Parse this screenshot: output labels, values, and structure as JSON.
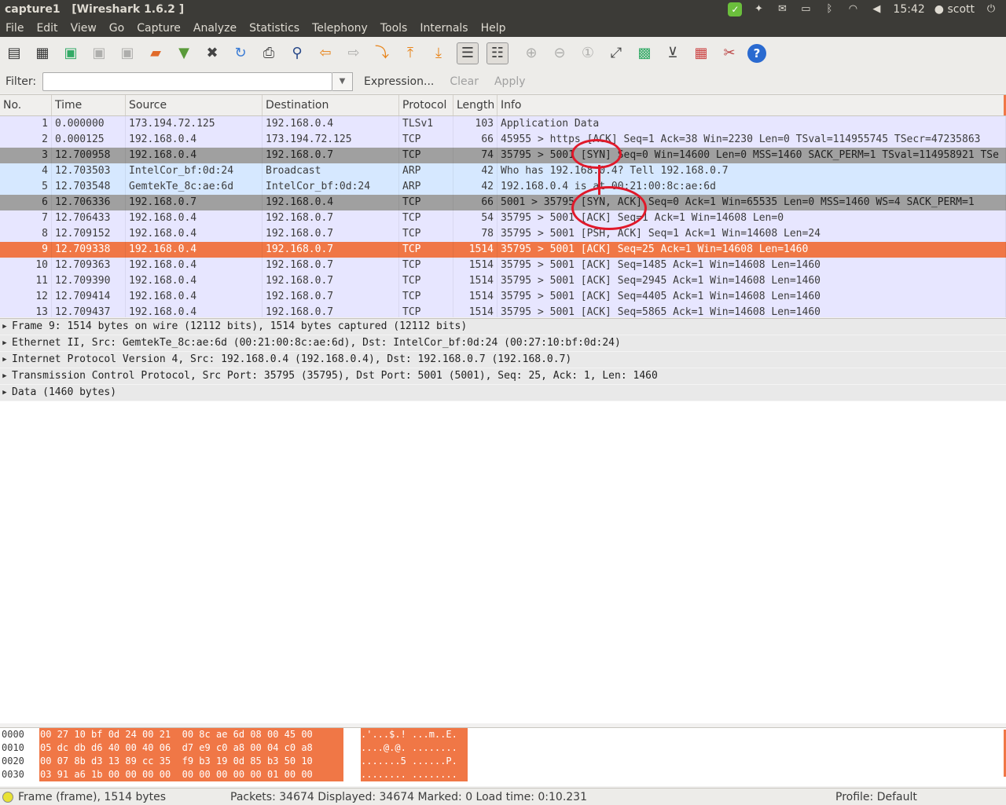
{
  "window": {
    "title": "capture1   [Wireshark 1.6.2 ]",
    "clock": "15:42",
    "user": "scott"
  },
  "menu": [
    "File",
    "Edit",
    "View",
    "Go",
    "Capture",
    "Analyze",
    "Statistics",
    "Telephony",
    "Tools",
    "Internals",
    "Help"
  ],
  "filter": {
    "label": "Filter:",
    "value": "",
    "expression": "Expression...",
    "clear": "Clear",
    "apply": "Apply"
  },
  "columns": {
    "no": "No.",
    "time": "Time",
    "source": "Source",
    "destination": "Destination",
    "protocol": "Protocol",
    "length": "Length",
    "info": "Info"
  },
  "packets": [
    {
      "no": "1",
      "time": "0.000000",
      "src": "173.194.72.125",
      "dst": "192.168.0.4",
      "proto": "TLSv1",
      "len": "103",
      "info": "Application Data"
    },
    {
      "no": "2",
      "time": "0.000125",
      "src": "192.168.0.4",
      "dst": "173.194.72.125",
      "proto": "TCP",
      "len": "66",
      "info": "45955 > https [ACK] Seq=1 Ack=38 Win=2230 Len=0 TSval=114955745 TSecr=47235863"
    },
    {
      "no": "3",
      "time": "12.700958",
      "src": "192.168.0.4",
      "dst": "192.168.0.7",
      "proto": "TCP",
      "len": "74",
      "info": "35795 > 5001 [SYN] Seq=0 Win=14600 Len=0 MSS=1460 SACK_PERM=1 TSval=114958921 TSe"
    },
    {
      "no": "4",
      "time": "12.703503",
      "src": "IntelCor_bf:0d:24",
      "dst": "Broadcast",
      "proto": "ARP",
      "len": "42",
      "info": "Who has 192.168.0.4?  Tell 192.168.0.7"
    },
    {
      "no": "5",
      "time": "12.703548",
      "src": "GemtekTe_8c:ae:6d",
      "dst": "IntelCor_bf:0d:24",
      "proto": "ARP",
      "len": "42",
      "info": "192.168.0.4 is at 00:21:00:8c:ae:6d"
    },
    {
      "no": "6",
      "time": "12.706336",
      "src": "192.168.0.7",
      "dst": "192.168.0.4",
      "proto": "TCP",
      "len": "66",
      "info": "5001 > 35795 [SYN, ACK] Seq=0 Ack=1 Win=65535 Len=0 MSS=1460 WS=4 SACK_PERM=1"
    },
    {
      "no": "7",
      "time": "12.706433",
      "src": "192.168.0.4",
      "dst": "192.168.0.7",
      "proto": "TCP",
      "len": "54",
      "info": "35795 > 5001 [ACK] Seq=1 Ack=1 Win=14608 Len=0"
    },
    {
      "no": "8",
      "time": "12.709152",
      "src": "192.168.0.4",
      "dst": "192.168.0.7",
      "proto": "TCP",
      "len": "78",
      "info": "35795 > 5001 [PSH, ACK] Seq=1 Ack=1 Win=14608 Len=24"
    },
    {
      "no": "9",
      "time": "12.709338",
      "src": "192.168.0.4",
      "dst": "192.168.0.7",
      "proto": "TCP",
      "len": "1514",
      "info": "35795 > 5001 [ACK] Seq=25 Ack=1 Win=14608 Len=1460"
    },
    {
      "no": "10",
      "time": "12.709363",
      "src": "192.168.0.4",
      "dst": "192.168.0.7",
      "proto": "TCP",
      "len": "1514",
      "info": "35795 > 5001 [ACK] Seq=1485 Ack=1 Win=14608 Len=1460"
    },
    {
      "no": "11",
      "time": "12.709390",
      "src": "192.168.0.4",
      "dst": "192.168.0.7",
      "proto": "TCP",
      "len": "1514",
      "info": "35795 > 5001 [ACK] Seq=2945 Ack=1 Win=14608 Len=1460"
    },
    {
      "no": "12",
      "time": "12.709414",
      "src": "192.168.0.4",
      "dst": "192.168.0.7",
      "proto": "TCP",
      "len": "1514",
      "info": "35795 > 5001 [ACK] Seq=4405 Ack=1 Win=14608 Len=1460"
    },
    {
      "no": "13",
      "time": "12.709437",
      "src": "192.168.0.4",
      "dst": "192.168.0.7",
      "proto": "TCP",
      "len": "1514",
      "info": "35795 > 5001 [ACK] Seq=5865 Ack=1 Win=14608 Len=1460"
    }
  ],
  "details": [
    "Frame 9: 1514 bytes on wire (12112 bits), 1514 bytes captured (12112 bits)",
    "Ethernet II, Src: GemtekTe_8c:ae:6d (00:21:00:8c:ae:6d), Dst: IntelCor_bf:0d:24 (00:27:10:bf:0d:24)",
    "Internet Protocol Version 4, Src: 192.168.0.4 (192.168.0.4), Dst: 192.168.0.7 (192.168.0.7)",
    "Transmission Control Protocol, Src Port: 35795 (35795), Dst Port: 5001 (5001), Seq: 25, Ack: 1, Len: 1460",
    "Data (1460 bytes)"
  ],
  "hex": [
    {
      "off": "0000",
      "bytes": "00 27 10 bf 0d 24 00 21  00 8c ae 6d 08 00 45 00",
      "ascii": ".'...$.! ...m..E."
    },
    {
      "off": "0010",
      "bytes": "05 dc db d6 40 00 40 06  d7 e9 c0 a8 00 04 c0 a8",
      "ascii": "....@.@. ........"
    },
    {
      "off": "0020",
      "bytes": "00 07 8b d3 13 89 cc 35  f9 b3 19 0d 85 b3 50 10",
      "ascii": ".......5 ......P."
    },
    {
      "off": "0030",
      "bytes": "03 91 a6 1b 00 00 00 00  00 00 00 00 00 01 00 00",
      "ascii": "........ ........"
    }
  ],
  "status": {
    "frame": "Frame (frame), 1514 bytes",
    "packets": "Packets: 34674 Displayed: 34674 Marked: 0 Load time: 0:10.231",
    "profile": "Profile: Default"
  },
  "colors": {
    "selected": "#f07746",
    "syn_row": "#a0a0a0",
    "tcp_row": "#e7e6ff",
    "arp_row": "#d6e8ff",
    "annotation": "#e0192a"
  }
}
